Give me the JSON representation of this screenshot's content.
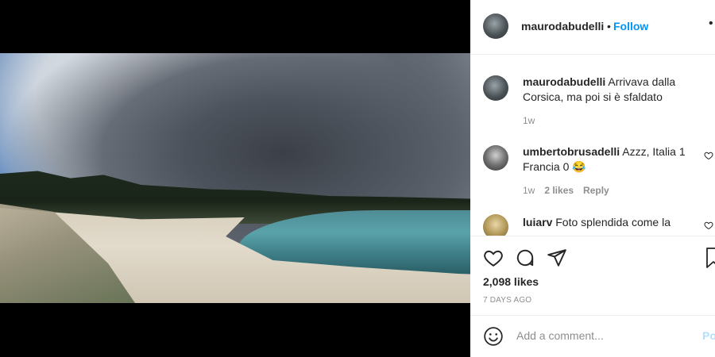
{
  "post": {
    "image_description_icon": "photo-landscape",
    "author": "maurodabudelli",
    "follow_label": "Follow",
    "separator": "•",
    "more_icon": "more-icon"
  },
  "comments": [
    {
      "user": "maurodabudelli",
      "text": "Arrivava dalla Corsica, ma poi si è sfaldato",
      "time": "1w"
    },
    {
      "user": "umbertobrusadelli",
      "text": "Azzz, Italia 1 Francia 0 😂",
      "time": "1w",
      "likes": "2 likes",
      "reply": "Reply"
    },
    {
      "user": "luiarv",
      "text": "Foto splendida come la"
    }
  ],
  "actions": {
    "likes": "2,098 likes",
    "date": "7 DAYS AGO"
  },
  "add_comment": {
    "placeholder": "Add a comment...",
    "post_label": "Po"
  },
  "colors": {
    "accent": "#0095f6",
    "text": "#262626",
    "muted": "#8e8e8e"
  }
}
